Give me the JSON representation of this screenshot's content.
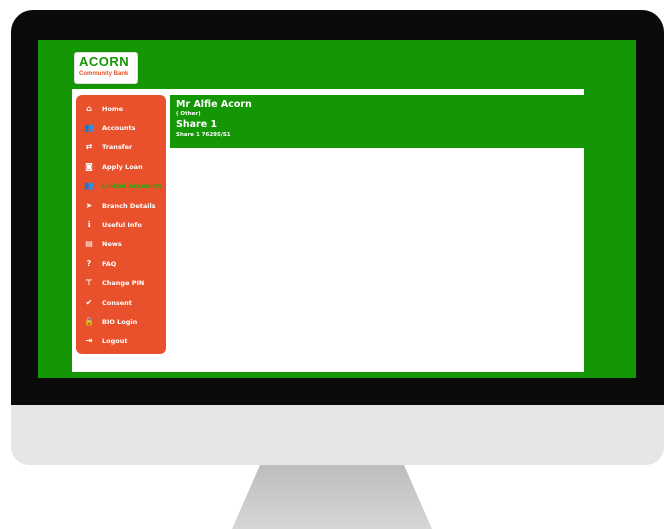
{
  "brand": {
    "name": "ACORN",
    "tagline": "Community Bank"
  },
  "sidebar": {
    "items": [
      {
        "label": "Home",
        "icon": "home-icon",
        "glyph": "⌂"
      },
      {
        "label": "Accounts",
        "icon": "users-icon",
        "glyph": "👥"
      },
      {
        "label": "Transfer",
        "icon": "transfer-icon",
        "glyph": "⇄"
      },
      {
        "label": "Apply Loan",
        "icon": "camera-icon",
        "glyph": "◙"
      },
      {
        "label": "Linked Accounts",
        "icon": "linked-users-icon",
        "glyph": "👥",
        "active": true
      },
      {
        "label": "Branch Details",
        "icon": "location-arrow-icon",
        "glyph": "➤"
      },
      {
        "label": "Useful Info",
        "icon": "info-icon",
        "glyph": "ℹ"
      },
      {
        "label": "News",
        "icon": "news-icon",
        "glyph": "▤"
      },
      {
        "label": "FAQ",
        "icon": "question-icon",
        "glyph": "?"
      },
      {
        "label": "Change PIN",
        "icon": "pin-icon",
        "glyph": "⊤"
      },
      {
        "label": "Consent",
        "icon": "check-circle-icon",
        "glyph": "✔"
      },
      {
        "label": "BIO Login",
        "icon": "lock-icon",
        "glyph": "🔒"
      },
      {
        "label": "Logout",
        "icon": "logout-icon",
        "glyph": "⇥"
      }
    ]
  },
  "account": {
    "holder": "Mr Alfie Acorn",
    "type": "( Other)",
    "product": "Share 1",
    "number": "Share 1 76295/S1"
  },
  "colors": {
    "green": "#149605",
    "orange": "#e8512b"
  }
}
